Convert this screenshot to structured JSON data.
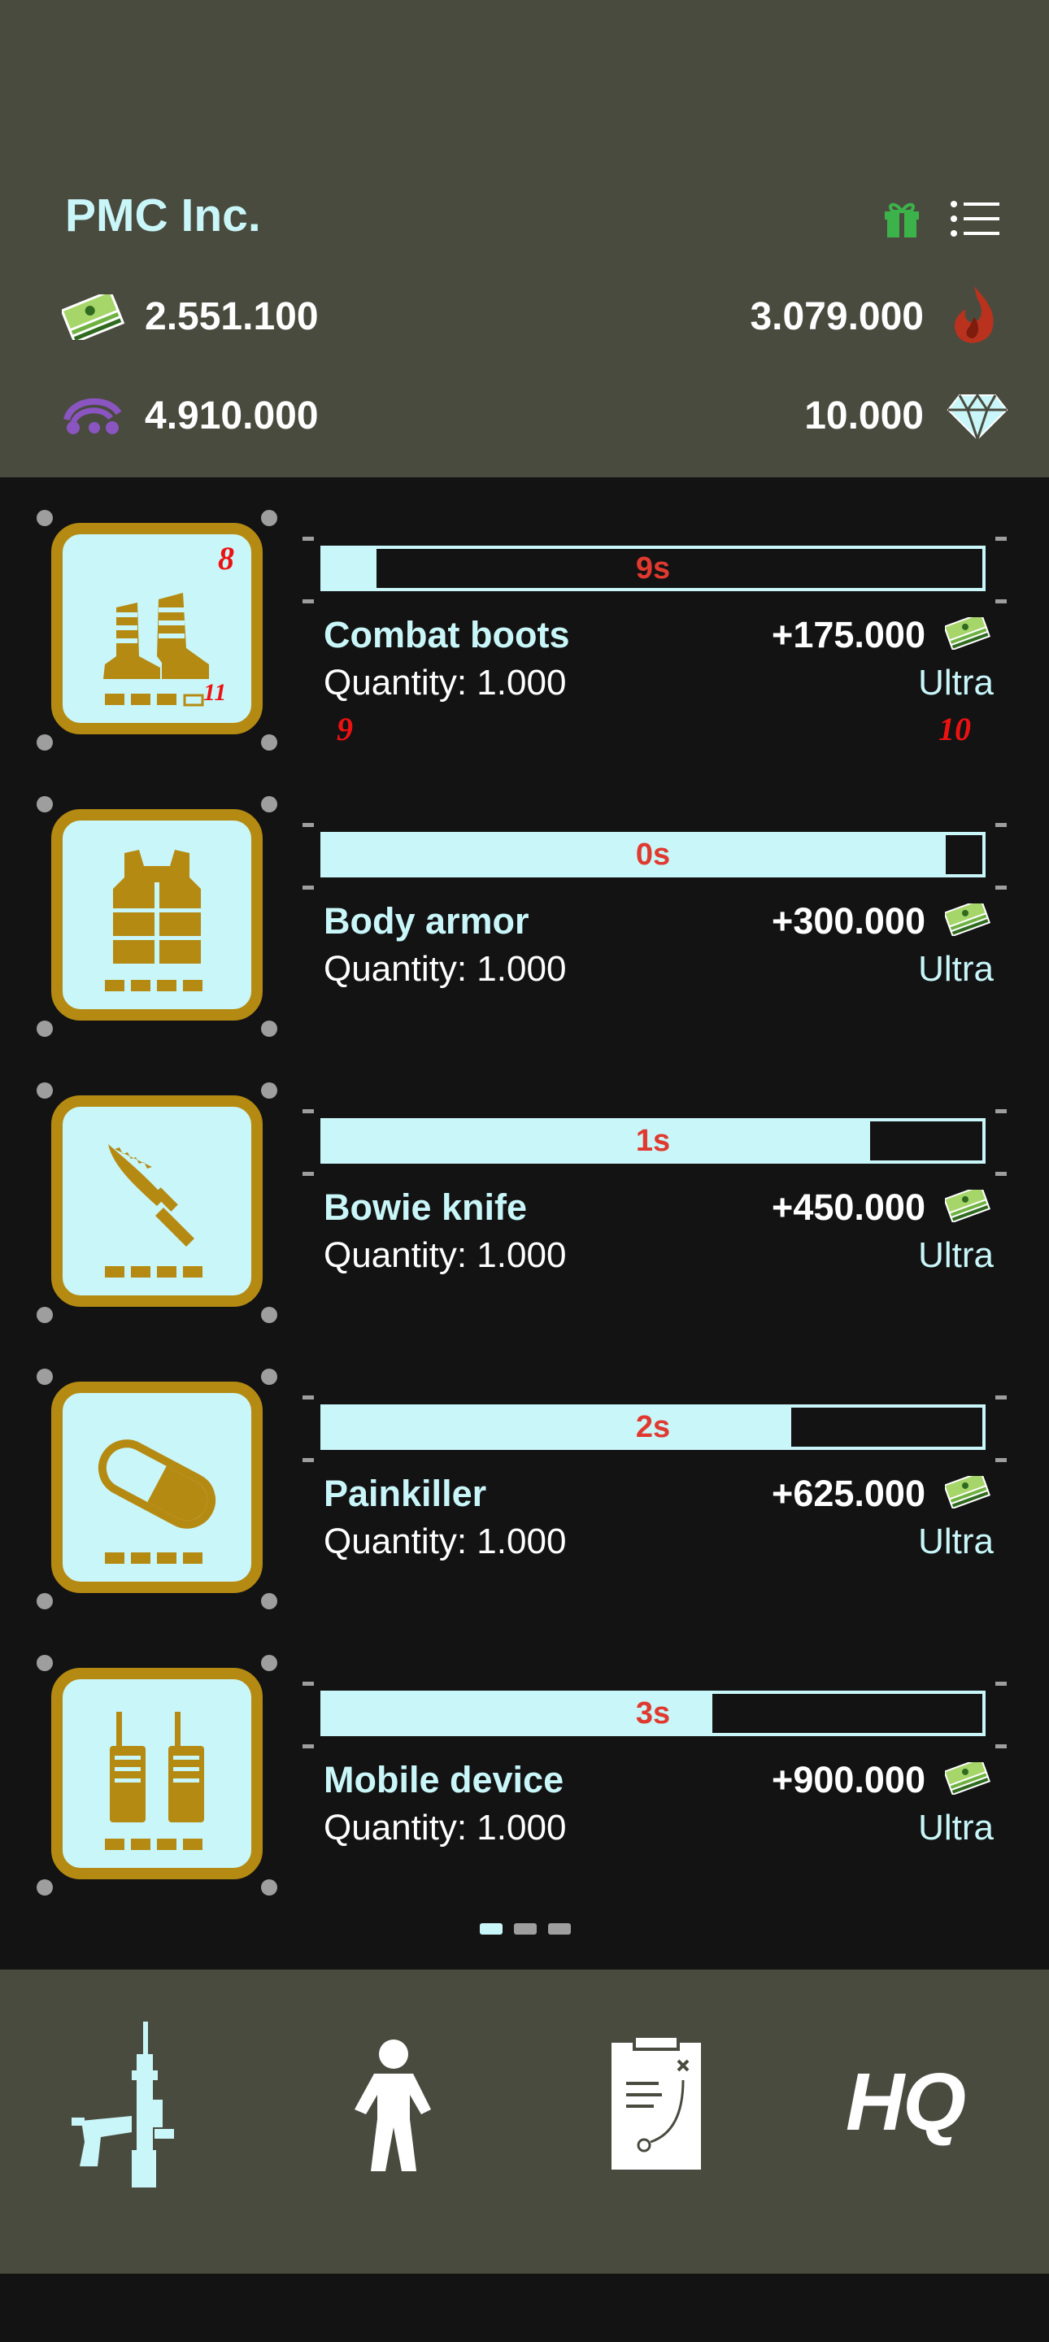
{
  "header": {
    "company": "PMC Inc.",
    "gift_icon": "gift-icon",
    "menu_icon": "list-menu-icon",
    "cash": {
      "icon": "cash-stack-icon",
      "value": "2.551.100"
    },
    "fire": {
      "icon": "flame-icon",
      "value": "3.079.000"
    },
    "intel": {
      "icon": "satellite-icon",
      "value": "4.910.000"
    },
    "diamonds": {
      "icon": "diamond-icon",
      "value": "10.000"
    }
  },
  "items": [
    {
      "name": "Combat boots",
      "quantity": "Quantity: 1.000",
      "reward": "+175.000",
      "tier": "Ultra",
      "timer": "9s",
      "progress": 0.08,
      "icon": "boots-icon"
    },
    {
      "name": "Body armor",
      "quantity": "Quantity: 1.000",
      "reward": "+300.000",
      "tier": "Ultra",
      "timer": "0s",
      "progress": 0.945,
      "icon": "vest-icon"
    },
    {
      "name": "Bowie knife",
      "quantity": "Quantity: 1.000",
      "reward": "+450.000",
      "tier": "Ultra",
      "timer": "1s",
      "progress": 0.83,
      "icon": "knife-icon"
    },
    {
      "name": "Painkiller",
      "quantity": "Quantity: 1.000",
      "reward": "+625.000",
      "tier": "Ultra",
      "timer": "2s",
      "progress": 0.71,
      "icon": "pill-icon"
    },
    {
      "name": "Mobile device",
      "quantity": "Quantity: 1.000",
      "reward": "+900.000",
      "tier": "Ultra",
      "timer": "3s",
      "progress": 0.59,
      "icon": "radio-icon"
    }
  ],
  "debug_labels": [
    "8",
    "11",
    "9",
    "10"
  ],
  "pager": {
    "pages": 3,
    "active": 1
  },
  "nav": [
    {
      "label": "Weapons",
      "icon": "weapons-icon"
    },
    {
      "label": "Soldier",
      "icon": "soldier-icon"
    },
    {
      "label": "Tactics",
      "icon": "clipboard-icon"
    },
    {
      "label": "HQ",
      "icon": "hq-icon"
    }
  ],
  "nav_hq_text": "HQ",
  "colors": {
    "accent": "#c9f6f8",
    "gold": "#b58a12",
    "header_bg": "#4a4b3f",
    "list_bg": "#131314",
    "timer_red": "#e0392f"
  }
}
